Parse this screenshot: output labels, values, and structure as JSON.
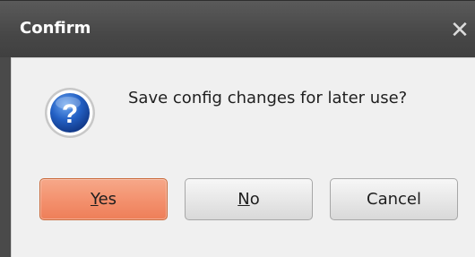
{
  "dialog": {
    "title": "Confirm",
    "close_glyph": "✕",
    "message": "Save config changes for later use?",
    "icon": "question-icon",
    "buttons": {
      "yes": {
        "accel": "Y",
        "rest": "es"
      },
      "no": {
        "accel": "N",
        "rest": "o"
      },
      "cancel": {
        "label": "Cancel"
      }
    }
  },
  "colors": {
    "titlebar": "#474747",
    "client": "#f0f0f0",
    "default_button": "#f3906d",
    "icon_blue": "#1a52b5"
  }
}
